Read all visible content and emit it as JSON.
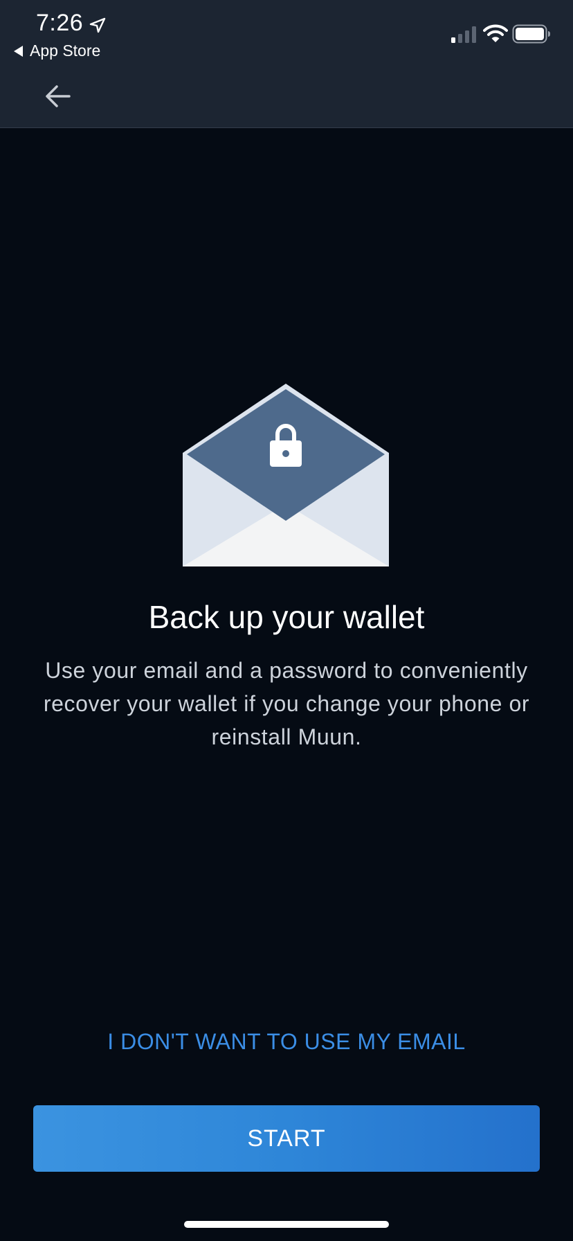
{
  "status_bar": {
    "time": "7:26",
    "back_to_app_label": "App Store",
    "location_icon": "location-arrow-icon",
    "signal_icon": "cellular-signal-icon",
    "wifi_icon": "wifi-icon",
    "battery_icon": "battery-icon"
  },
  "nav": {
    "back_icon": "arrow-left-icon"
  },
  "illustration": {
    "icon": "envelope-lock-icon",
    "colors": {
      "flap": "#4e6a8c",
      "body": "#dde4ee",
      "front": "#f3f4f5",
      "lock": "#ffffff"
    }
  },
  "content": {
    "title": "Back up your wallet",
    "description": "Use your email and a password to conveniently recover your wallet if you change your phone or reinstall Muun."
  },
  "actions": {
    "skip_label": "I DON'T WANT TO USE MY EMAIL",
    "start_label": "START"
  },
  "colors": {
    "background": "#050b14",
    "topbar": "#1c2532",
    "accent": "#3b8ee6"
  }
}
